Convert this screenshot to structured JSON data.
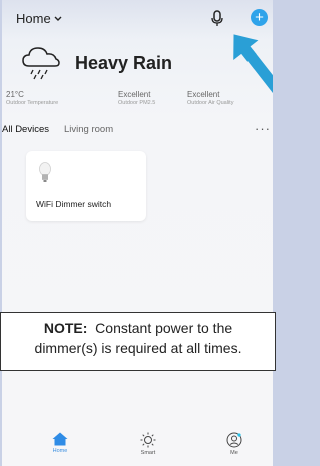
{
  "header": {
    "home_label": "Home",
    "dropdown_icon": "chevron-down-icon",
    "mic_icon": "microphone-icon",
    "add_icon": "plus-icon",
    "add_symbol": "+"
  },
  "weather": {
    "title": "Heavy Rain",
    "icon": "rain-cloud-icon",
    "metrics": [
      {
        "value": "21°C",
        "label": "Outdoor Temperature"
      },
      {
        "value": "Excellent",
        "label": "Outdoor PM2.5"
      },
      {
        "value": "Excellent",
        "label": "Outdoor Air Quality"
      }
    ]
  },
  "tabs": {
    "items": [
      "All Devices",
      "Living room"
    ],
    "active": "All Devices",
    "more_label": "···"
  },
  "devices": [
    {
      "name": "WiFi Dimmer switch",
      "icon": "light-bulb-icon"
    }
  ],
  "note": {
    "label": "NOTE:",
    "text_line1": "Constant power to the",
    "text_line2": "dimmer(s) is required at all times."
  },
  "bottom_nav": {
    "items": [
      {
        "label": "Home",
        "icon": "home-icon"
      },
      {
        "label": "Smart",
        "icon": "sun-icon"
      },
      {
        "label": "Me",
        "icon": "user-icon"
      }
    ],
    "active": "Home"
  },
  "colors": {
    "accent": "#2fa3ea",
    "nav_active": "#3b8fe0",
    "arrow": "#2a9fd6"
  }
}
